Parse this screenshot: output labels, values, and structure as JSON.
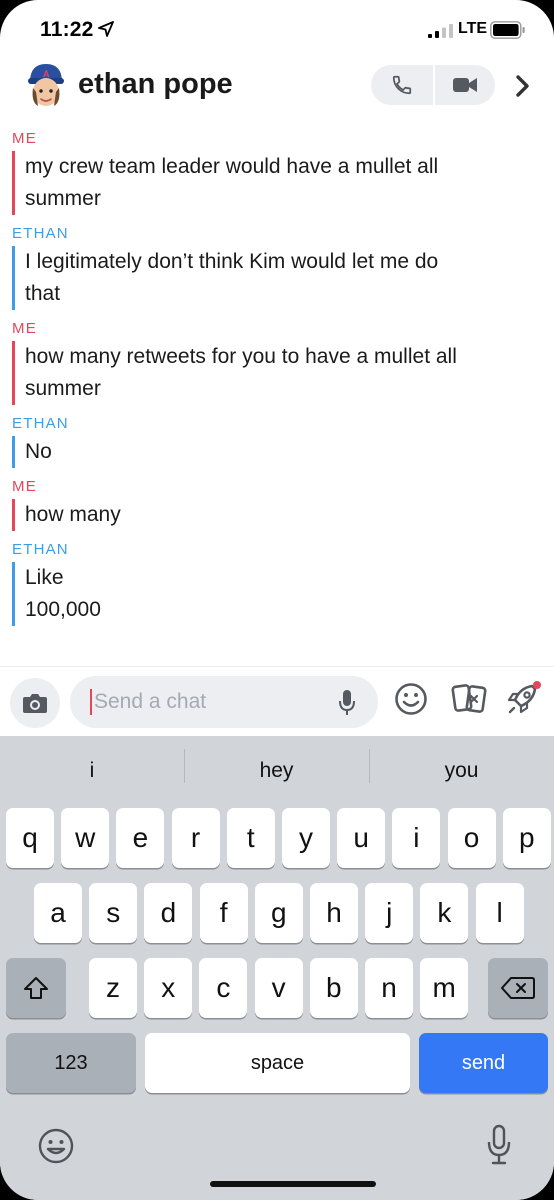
{
  "status_bar": {
    "time": "11:22",
    "network": "LTE"
  },
  "header": {
    "contact_name": "ethan pope",
    "phone_icon": "phone-icon",
    "video_icon": "video-icon",
    "chevron_icon": "chevron-right-icon"
  },
  "messages": [
    {
      "sender": "ME",
      "role": "me",
      "lines": [
        "my crew team leader would have a mullet all",
        "summer"
      ]
    },
    {
      "sender": "ETHAN",
      "role": "ethan",
      "lines": [
        "I legitimately don’t think Kim would let me do",
        "that"
      ]
    },
    {
      "sender": "ME",
      "role": "me",
      "lines": [
        "how many retweets for you to have a mullet all",
        "summer"
      ]
    },
    {
      "sender": "ETHAN",
      "role": "ethan",
      "lines": [
        "No"
      ]
    },
    {
      "sender": "ME",
      "role": "me",
      "lines": [
        "how many"
      ]
    },
    {
      "sender": "ETHAN",
      "role": "ethan",
      "lines": [
        "Like",
        "100,000"
      ]
    }
  ],
  "composer": {
    "placeholder": "Send a chat"
  },
  "keyboard": {
    "suggestions": [
      "i",
      "hey",
      "you"
    ],
    "row1": [
      "q",
      "w",
      "e",
      "r",
      "t",
      "y",
      "u",
      "i",
      "o",
      "p"
    ],
    "row2": [
      "a",
      "s",
      "d",
      "f",
      "g",
      "h",
      "j",
      "k",
      "l"
    ],
    "row3": [
      "z",
      "x",
      "c",
      "v",
      "b",
      "n",
      "m"
    ],
    "numbers_label": "123",
    "space_label": "space",
    "send_label": "send"
  },
  "colors": {
    "me": "#e4475a",
    "ethan": "#3d9ee8",
    "send": "#3478f6"
  }
}
